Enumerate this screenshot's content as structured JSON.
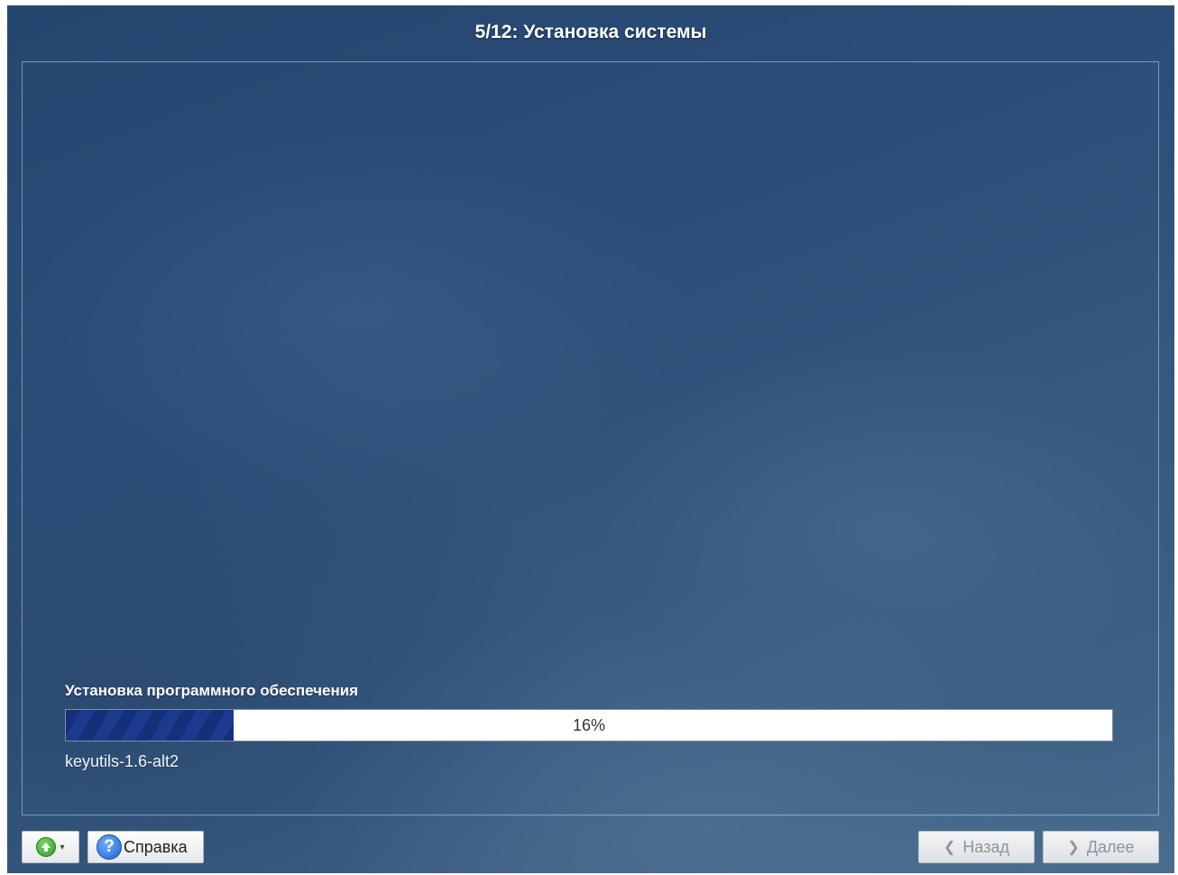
{
  "window": {
    "title": "5/12: Установка системы"
  },
  "install": {
    "section_label": "Установка программного обеспечения",
    "progress": {
      "percent": 16,
      "text": "16%"
    },
    "current_package": "keyutils-1.6-alt2"
  },
  "toolbar": {
    "menu_icon": "green-up-arrow-icon",
    "help_icon": "question-mark-icon",
    "help_label": "Справка",
    "help_icon_glyph": "?",
    "back_label": "Назад",
    "next_label": "Далее"
  }
}
